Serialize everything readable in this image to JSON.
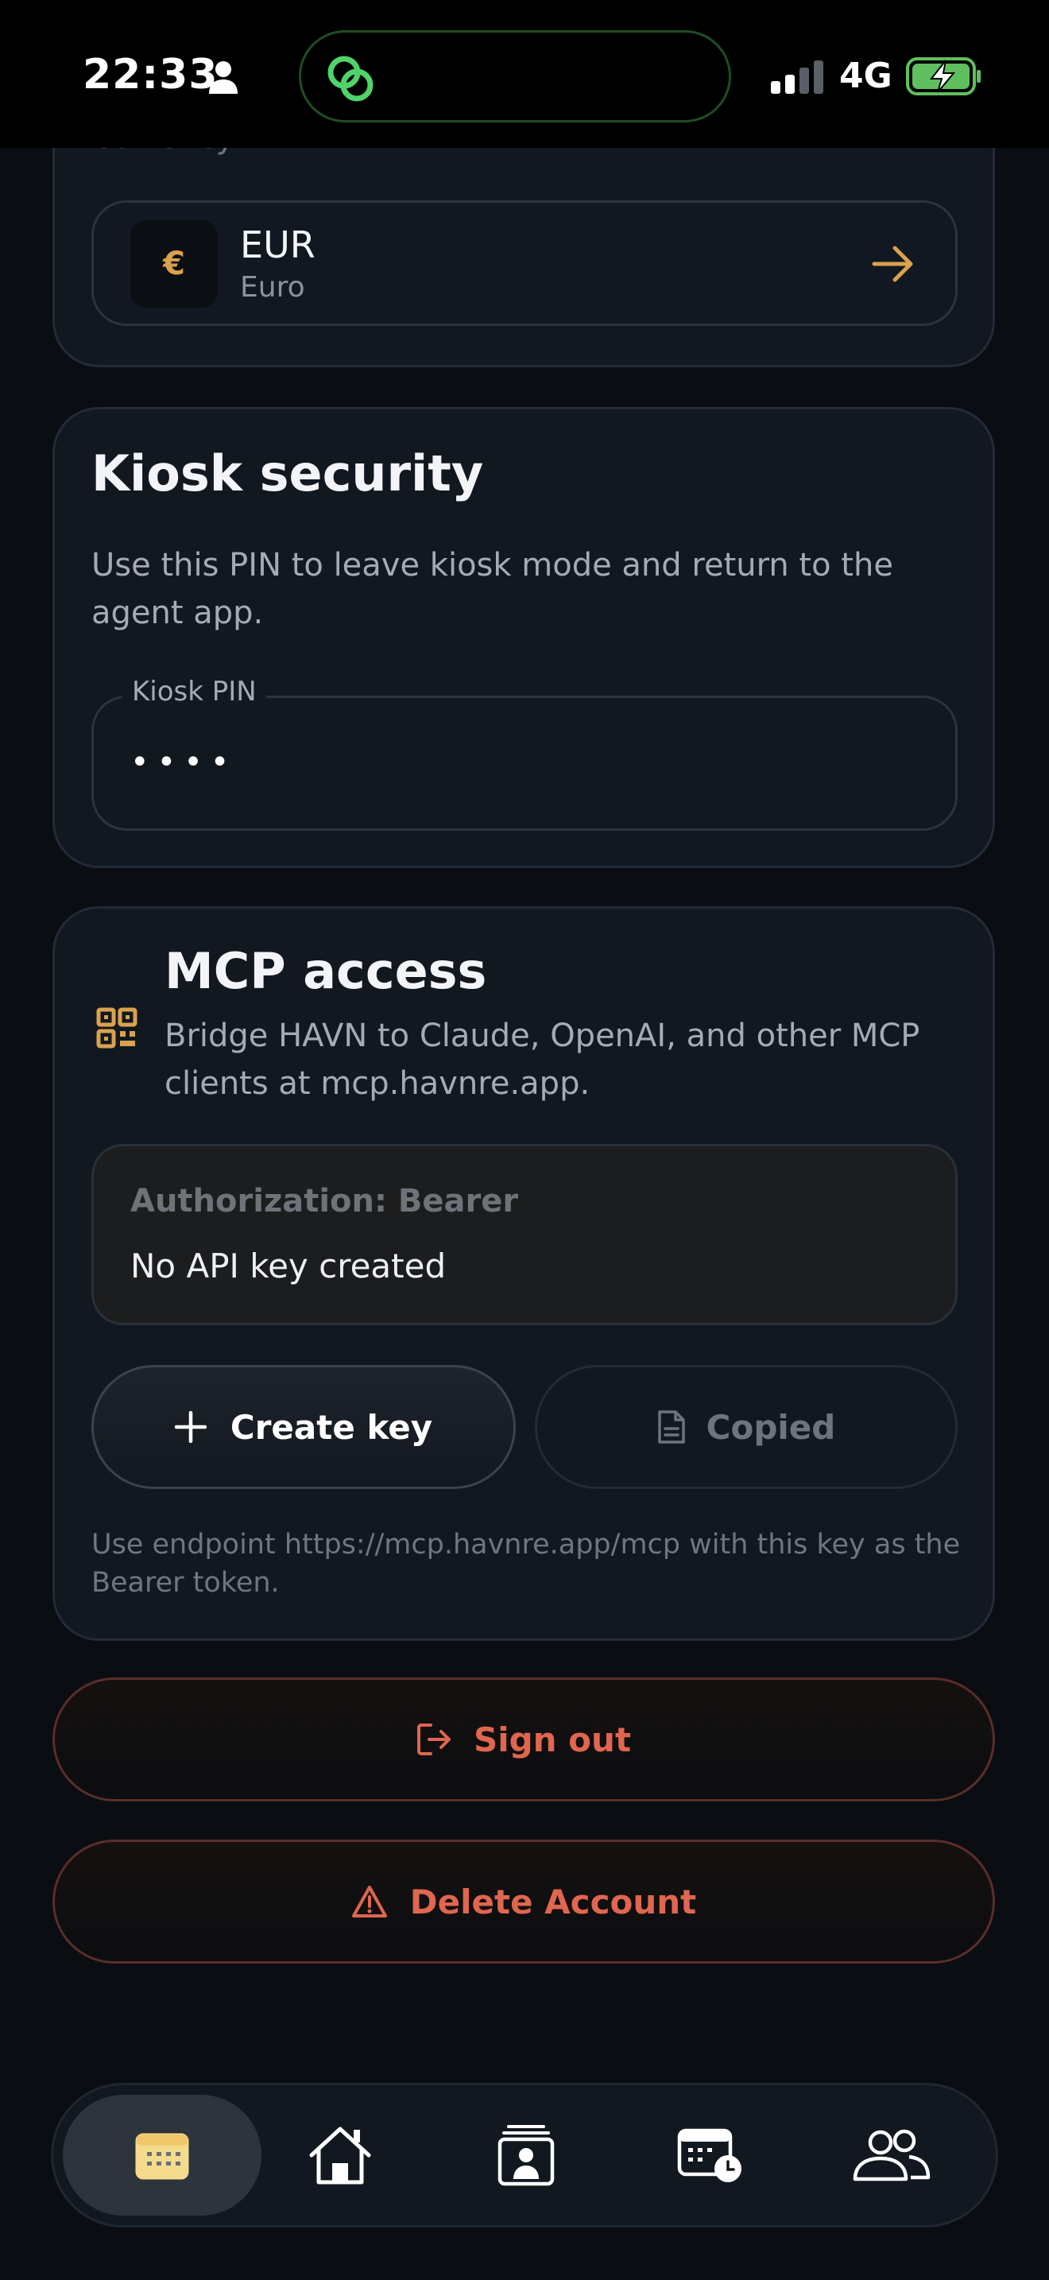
{
  "status_bar": {
    "time": "22:33",
    "network": "4G"
  },
  "currency": {
    "section_label": "Currency",
    "symbol": "€",
    "code": "EUR",
    "name": "Euro"
  },
  "kiosk": {
    "title": "Kiosk security",
    "description": "Use this PIN to leave kiosk mode and return to the agent app.",
    "pin_label": "Kiosk PIN",
    "pin_value": "••••"
  },
  "mcp": {
    "title": "MCP access",
    "description": "Bridge HAVN to Claude, OpenAI, and other MCP clients at mcp.havnre.app.",
    "auth_label": "Authorization: Bearer",
    "auth_value": "No API key created",
    "create_label": "Create key",
    "copied_label": "Copied",
    "note": "Use endpoint https://mcp.havnre.app/mcp with this key as the Bearer token."
  },
  "actions": {
    "sign_out": "Sign out",
    "delete_account": "Delete Account"
  },
  "nav": {
    "items": [
      "calendar-icon",
      "home-icon",
      "contact-card-icon",
      "schedule-icon",
      "people-icon"
    ],
    "active_index": 0
  },
  "colors": {
    "accent_gold": "#d9a24e",
    "danger": "#e0664f",
    "background": "#0a0d12",
    "card": "#121820"
  }
}
